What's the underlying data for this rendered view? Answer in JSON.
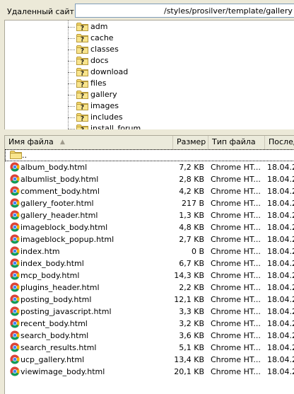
{
  "remote": {
    "label": "Удаленный сайт:",
    "path": "/styles/prosilver/template/gallery"
  },
  "tree": {
    "items": [
      {
        "label": "adm"
      },
      {
        "label": "cache"
      },
      {
        "label": "classes"
      },
      {
        "label": "docs"
      },
      {
        "label": "download"
      },
      {
        "label": "files"
      },
      {
        "label": "gallery"
      },
      {
        "label": "images"
      },
      {
        "label": "includes"
      },
      {
        "label": "install_forum"
      }
    ]
  },
  "list": {
    "columns": {
      "name": "Имя файла",
      "size": "Размер",
      "type": "Тип файла",
      "modified": "Послед"
    },
    "up_label": "..",
    "files": [
      {
        "name": "album_body.html",
        "size": "7,2 KB",
        "type": "Chrome HT...",
        "date": "18.04.2"
      },
      {
        "name": "albumlist_body.html",
        "size": "2,8 KB",
        "type": "Chrome HT...",
        "date": "18.04.2"
      },
      {
        "name": "comment_body.html",
        "size": "4,2 KB",
        "type": "Chrome HT...",
        "date": "18.04.2"
      },
      {
        "name": "gallery_footer.html",
        "size": "217 B",
        "type": "Chrome HT...",
        "date": "18.04.2"
      },
      {
        "name": "gallery_header.html",
        "size": "1,3 KB",
        "type": "Chrome HT...",
        "date": "18.04.2"
      },
      {
        "name": "imageblock_body.html",
        "size": "4,8 KB",
        "type": "Chrome HT...",
        "date": "18.04.2"
      },
      {
        "name": "imageblock_popup.html",
        "size": "2,7 KB",
        "type": "Chrome HT...",
        "date": "18.04.2"
      },
      {
        "name": "index.htm",
        "size": "0 B",
        "type": "Chrome HT...",
        "date": "18.04.2"
      },
      {
        "name": "index_body.html",
        "size": "6,7 KB",
        "type": "Chrome HT...",
        "date": "18.04.2"
      },
      {
        "name": "mcp_body.html",
        "size": "14,3 KB",
        "type": "Chrome HT...",
        "date": "18.04.2"
      },
      {
        "name": "plugins_header.html",
        "size": "2,2 KB",
        "type": "Chrome HT...",
        "date": "18.04.2"
      },
      {
        "name": "posting_body.html",
        "size": "12,1 KB",
        "type": "Chrome HT...",
        "date": "18.04.2"
      },
      {
        "name": "posting_javascript.html",
        "size": "3,3 KB",
        "type": "Chrome HT...",
        "date": "18.04.2"
      },
      {
        "name": "recent_body.html",
        "size": "3,2 KB",
        "type": "Chrome HT...",
        "date": "18.04.2"
      },
      {
        "name": "search_body.html",
        "size": "3,6 KB",
        "type": "Chrome HT...",
        "date": "18.04.2"
      },
      {
        "name": "search_results.html",
        "size": "5,1 KB",
        "type": "Chrome HT...",
        "date": "18.04.2"
      },
      {
        "name": "ucp_gallery.html",
        "size": "13,4 KB",
        "type": "Chrome HT...",
        "date": "18.04.2"
      },
      {
        "name": "viewimage_body.html",
        "size": "20,1 KB",
        "type": "Chrome HT...",
        "date": "18.04.2"
      }
    ]
  },
  "colors": {
    "panel_bg": "#ece9d8",
    "folder_yellow": "#f5d86b",
    "header_bg": "#ebeadb"
  }
}
